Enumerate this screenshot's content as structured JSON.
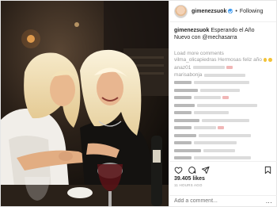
{
  "header": {
    "username": "gimenezsuok",
    "separator": "•",
    "follow_label": "Following"
  },
  "caption": {
    "username": "gimenezsuok",
    "text": "Esperando el Año Nuevo con @mechasarra"
  },
  "load_more_label": "Load more comments",
  "comments": [
    {
      "shown": "vilma_olicapiedras Hermosas feliz año"
    },
    {
      "shown": "anaz01"
    },
    {
      "shown": "marisabonja"
    },
    {
      "shown": ""
    },
    {
      "shown": ""
    },
    {
      "shown": ""
    },
    {
      "shown": ""
    },
    {
      "shown": ""
    },
    {
      "shown": ""
    },
    {
      "shown": ""
    },
    {
      "shown": ""
    },
    {
      "shown": ""
    },
    {
      "shown": ""
    },
    {
      "shown": ""
    },
    {
      "shown": ""
    },
    {
      "shown": "fidelnaschik"
    }
  ],
  "actions": {
    "likes": "39.405 likes",
    "time_ago": "11 HOURS AGO"
  },
  "add_comment": {
    "placeholder": "Add a comment...",
    "more_label": "..."
  },
  "colors": {
    "link_blue": "#3897f0",
    "border": "#efefef",
    "muted_text": "#999999"
  },
  "icons": [
    "heart-icon",
    "comment-icon",
    "share-icon",
    "bookmark-icon",
    "verified-badge-icon",
    "more-options-icon"
  ]
}
